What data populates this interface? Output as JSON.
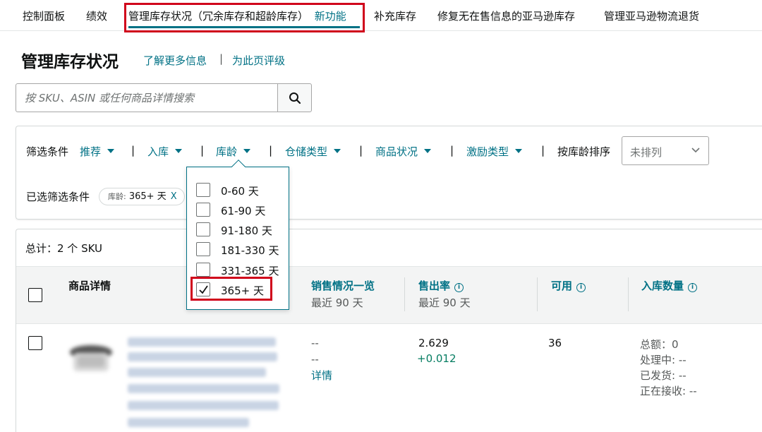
{
  "nav": {
    "items": [
      "控制面板",
      "绩效",
      "管理库存状况（冗余库存和超龄库存）",
      "补充库存",
      "修复无在售信息的亚马逊库存",
      "管理亚马逊物流退货"
    ],
    "new_badge": "新功能"
  },
  "header": {
    "title": "管理库存状况",
    "learn_more": "了解更多信息",
    "separator": "|",
    "rate_page": "为此页评级"
  },
  "search": {
    "placeholder": "按 SKU、ASIN 或任何商品详情搜索",
    "icon": "search-icon"
  },
  "filters": {
    "label": "筛选条件",
    "items": [
      "推荐",
      "入库",
      "库龄",
      "仓储类型",
      "商品状况",
      "激励类型"
    ],
    "separator": "|",
    "sort_label": "按库龄排序",
    "sort_value": "未排列",
    "selected_label": "已选筛选条件",
    "chip_key": "库龄:",
    "chip_value": "365+ 天",
    "chip_remove": "X"
  },
  "age_dropdown": {
    "options": [
      {
        "label": "0-60 天",
        "checked": false
      },
      {
        "label": "61-90 天",
        "checked": false
      },
      {
        "label": "91-180 天",
        "checked": false
      },
      {
        "label": "181-330 天",
        "checked": false
      },
      {
        "label": "331-365 天",
        "checked": false
      },
      {
        "label": "365+ 天",
        "checked": true
      }
    ]
  },
  "table": {
    "total": "总计：2 个 SKU",
    "columns": {
      "details": "商品详情",
      "sales": "销售情况一览",
      "sales_sub": "最近 90 天",
      "sell_through": "售出率",
      "sell_through_sub": "最近 90 天",
      "available": "可用",
      "inbound": "入库数量"
    },
    "rows": [
      {
        "sales_1": "--",
        "sales_2": "--",
        "details_link": "详情",
        "sell_through": "2.629",
        "sell_through_delta": "+0.012",
        "available": "36",
        "inbound_total": "总额：0",
        "inbound_processing": "处理中: --",
        "inbound_shipped": "已发货: --",
        "inbound_receiving": "正在接收: --"
      }
    ]
  },
  "colors": {
    "link": "#007185",
    "highlight": "#d0021b",
    "positive": "#067d62"
  }
}
